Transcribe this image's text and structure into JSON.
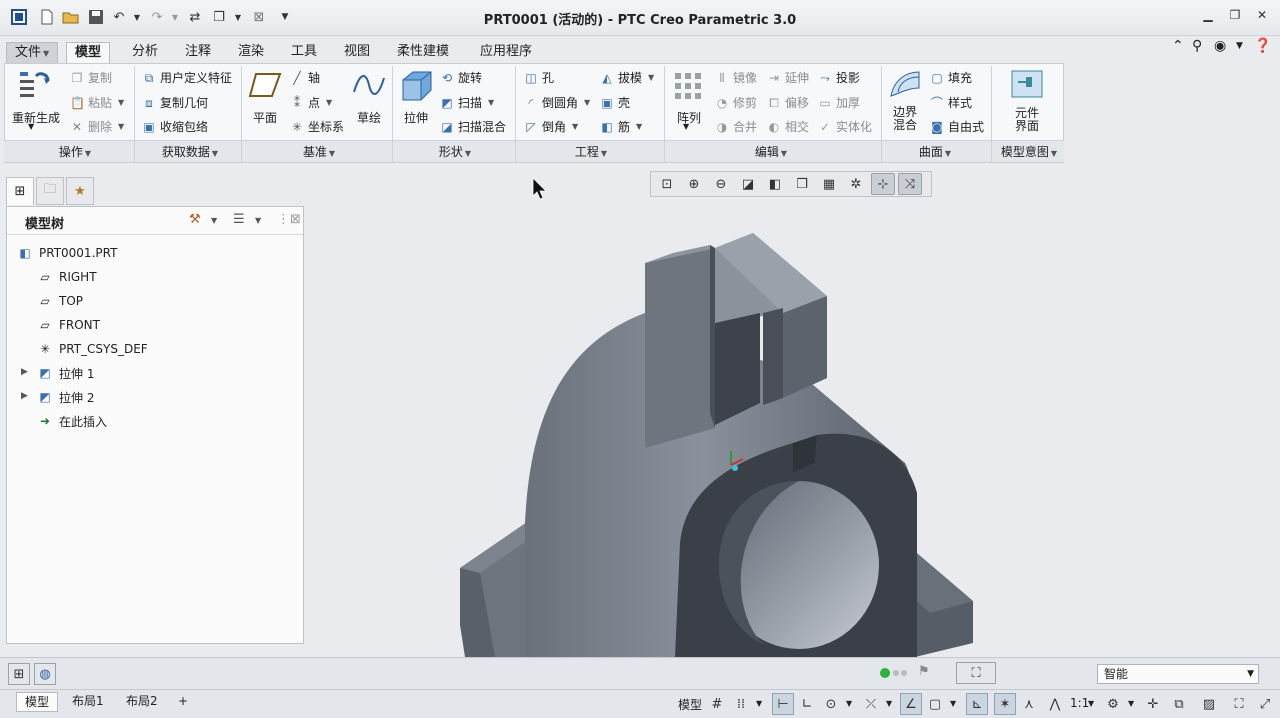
{
  "window": {
    "title": "PRT0001 (活动的) - PTC Creo Parametric 3.0"
  },
  "tabs": {
    "file": "文件",
    "items": [
      "模型",
      "分析",
      "注释",
      "渲染",
      "工具",
      "视图",
      "柔性建模",
      "应用程序"
    ]
  },
  "ribbon": {
    "operations": {
      "regenerate": "重新生成",
      "copy": "复制",
      "paste": "粘贴",
      "delete": "删除",
      "title": "操作"
    },
    "get_data": {
      "user_feature": "用户定义特征",
      "copy_geometry": "复制几何",
      "shrinkwrap": "收缩包络",
      "title": "获取数据"
    },
    "datum": {
      "plane": "平面",
      "axis": "轴",
      "point": "点",
      "csys": "坐标系",
      "sketch": "草绘",
      "title": "基准"
    },
    "shapes": {
      "extrude": "拉伸",
      "revolve": "旋转",
      "sweep": "扫描",
      "swept_blend": "扫描混合",
      "title": "形状"
    },
    "engineering": {
      "hole": "孔",
      "round": "倒圆角",
      "chamfer": "倒角",
      "draft": "拔模",
      "shell": "壳",
      "rib": "筋",
      "title": "工程"
    },
    "editing": {
      "pattern": "阵列",
      "mirror": "镜像",
      "trim": "修剪",
      "merge": "合并",
      "extend": "延伸",
      "offset": "偏移",
      "intersect": "相交",
      "project": "投影",
      "thicken": "加厚",
      "solidify": "实体化",
      "title": "编辑"
    },
    "surfaces": {
      "boundary_blend": "边界混合",
      "fill": "填充",
      "style": "样式",
      "freestyle": "自由式",
      "title": "曲面"
    },
    "model_intent": {
      "component_interface": "元件界面",
      "title": "模型意图"
    }
  },
  "model_tree": {
    "title": "模型树",
    "items": [
      "PRT0001.PRT",
      "RIGHT",
      "TOP",
      "FRONT",
      "PRT_CSYS_DEF",
      "拉伸 1",
      "拉伸 2",
      "在此插入"
    ]
  },
  "status": {
    "filter_value": "智能"
  },
  "bottom_tabs": [
    "模型",
    "布局1",
    "布局2"
  ],
  "bottom_toolbar": {
    "mode_label": "模型",
    "scale_label": "1:1"
  },
  "colors": {
    "part_light": "#8a919c",
    "part_dark": "#3b4048",
    "accent": "#3a6fb0"
  }
}
